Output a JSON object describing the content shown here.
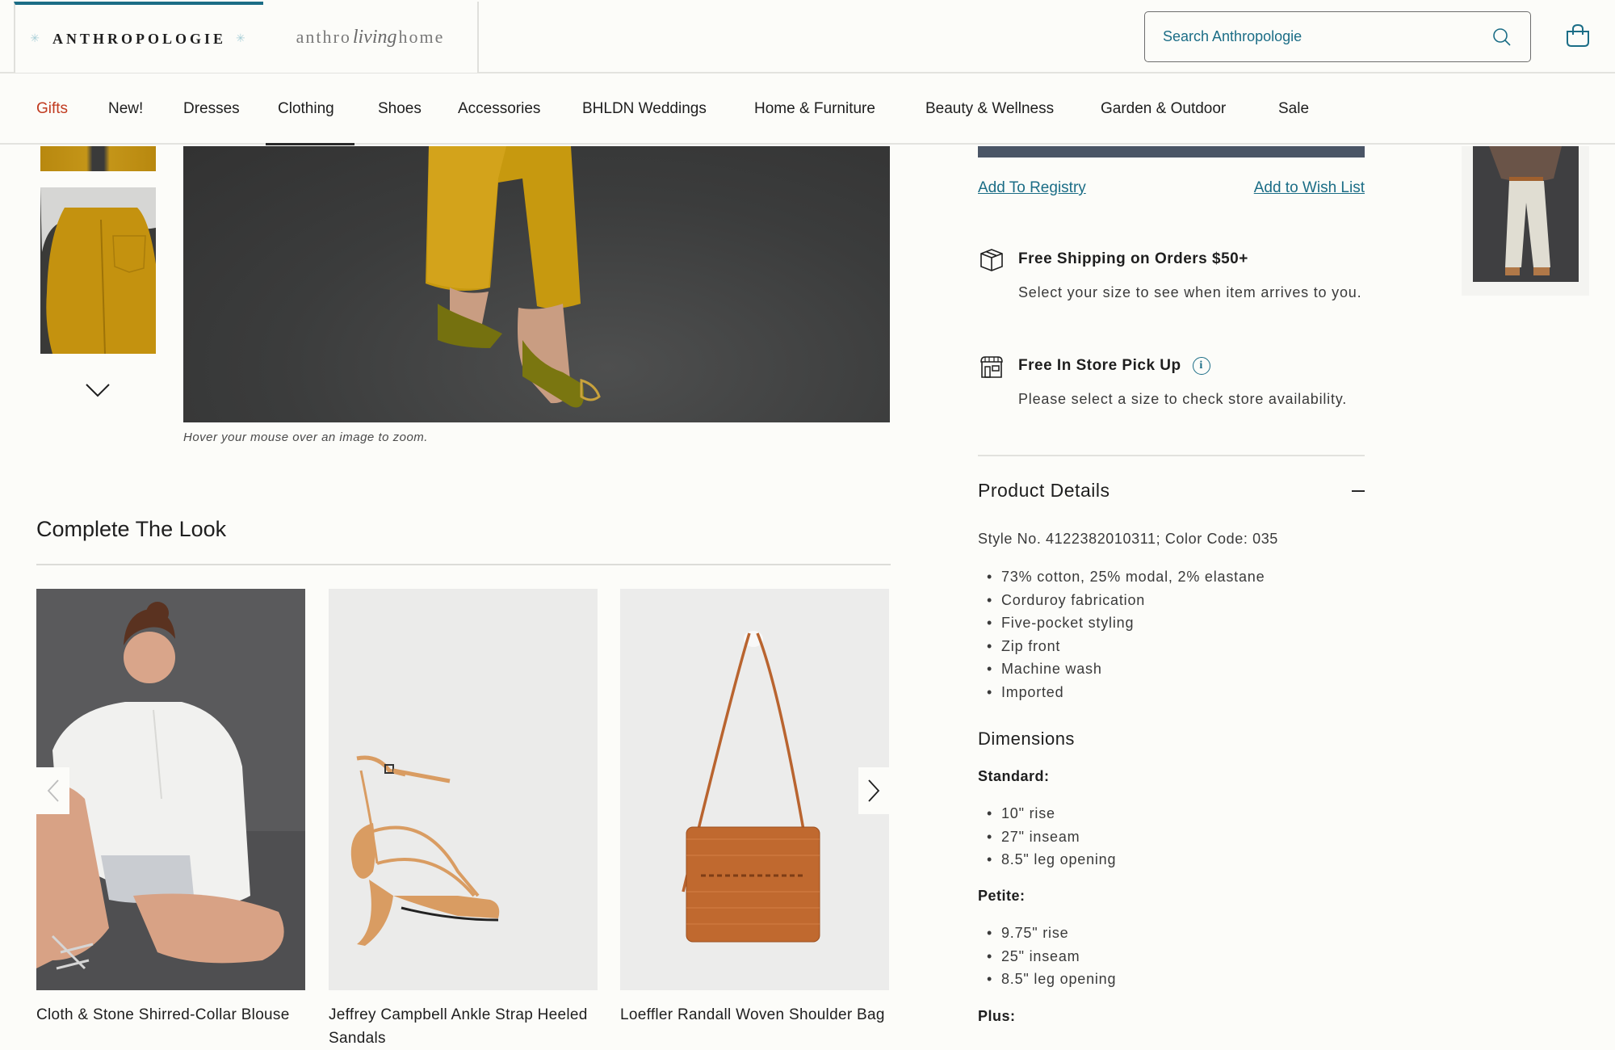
{
  "header": {
    "brand_tabs": [
      {
        "label": "ANTHROPOLOGIE",
        "active": true
      },
      {
        "label_left": "anthro",
        "label_script": "living",
        "label_right": "home",
        "active": false
      }
    ],
    "search": {
      "placeholder": "Search Anthropologie"
    },
    "icons": {
      "search": "search-icon",
      "cart": "shopping-bag-icon"
    }
  },
  "nav": {
    "items": [
      {
        "label": "Gifts",
        "highlight": true
      },
      {
        "label": "New!"
      },
      {
        "label": "Dresses"
      },
      {
        "label": "Clothing",
        "active": true
      },
      {
        "label": "Shoes"
      },
      {
        "label": "Accessories"
      },
      {
        "label": "BHLDN Weddings"
      },
      {
        "label": "Home & Furniture"
      },
      {
        "label": "Beauty & Wellness"
      },
      {
        "label": "Garden & Outdoor"
      },
      {
        "label": "Sale"
      }
    ]
  },
  "gallery": {
    "caption": "Hover your mouse over an image to zoom."
  },
  "complete_the_look": {
    "title": "Complete The Look",
    "products": [
      {
        "name": "Cloth & Stone Shirred-Collar Blouse"
      },
      {
        "name": "Jeffrey Campbell Ankle Strap Heeled Sandals"
      },
      {
        "name": "Loeffler Randall Woven Shoulder Bag"
      }
    ]
  },
  "purchase": {
    "add_to_registry": "Add To Registry",
    "add_to_wishlist": "Add to Wish List",
    "shipping": {
      "title": "Free Shipping on Orders $50+",
      "text": "Select your size to see when item arrives to you."
    },
    "pickup": {
      "title": "Free In Store Pick Up",
      "info_glyph": "i",
      "text": "Please select a size to check store availability."
    }
  },
  "product_details": {
    "title": "Product Details",
    "toggle": "collapse",
    "style_line": "Style No. 4122382010311; Color Code: 035",
    "features": [
      "73% cotton, 25% modal, 2% elastane",
      "Corduroy fabrication",
      "Five-pocket styling",
      "Zip front",
      "Machine wash",
      "Imported"
    ],
    "dimensions": {
      "title": "Dimensions",
      "groups": [
        {
          "label": "Standard:",
          "items": [
            "10\" rise",
            "27\" inseam",
            "8.5\" leg opening"
          ]
        },
        {
          "label": "Petite:",
          "items": [
            "9.75\" rise",
            "25\" inseam",
            "8.5\" leg opening"
          ]
        },
        {
          "label": "Plus:",
          "items": []
        }
      ]
    }
  },
  "colors": {
    "accent_teal": "#1b6d86",
    "gifts_red": "#c13b20",
    "button_slate": "#4a5566",
    "background": "#fcfcf9"
  }
}
